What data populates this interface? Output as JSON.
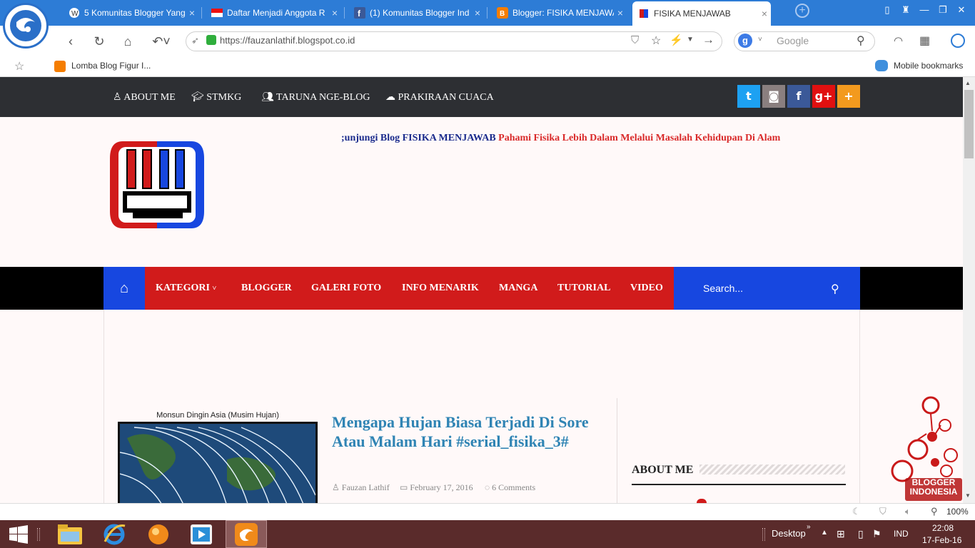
{
  "browser": {
    "tabs": [
      {
        "title": "5 Komunitas Blogger Yang",
        "favicon": "wordpress-icon"
      },
      {
        "title": "Daftar Menjadi Anggota R",
        "favicon": "indonesia-flag-icon"
      },
      {
        "title": "(1) Komunitas Blogger Ind",
        "favicon": "facebook-icon"
      },
      {
        "title": "Blogger: FISIKA MENJAWA",
        "favicon": "blogger-icon"
      },
      {
        "title": "FISIKA MENJAWAB",
        "favicon": "site-icon",
        "active": true
      }
    ],
    "url": "https://fauzanlathif.blogspot.co.id",
    "search_placeholder": "Google",
    "bookmarks": [
      {
        "label": "Lomba Blog Figur I..."
      }
    ],
    "mobile_bookmarks": "Mobile bookmarks",
    "zoom": "100%"
  },
  "site": {
    "top_nav": [
      "ABOUT ME",
      "STMKG",
      "TARUNA NGE-BLOG",
      "PRAKIRAAN CUACA"
    ],
    "social": [
      {
        "name": "twitter-icon",
        "glyph": "t",
        "color": "#1da1f2"
      },
      {
        "name": "instagram-icon",
        "glyph": "◙",
        "color": "#8a7f7f"
      },
      {
        "name": "facebook-icon",
        "glyph": "f",
        "color": "#3b5998"
      },
      {
        "name": "google-plus-icon",
        "glyph": "g+",
        "color": "#e01010"
      },
      {
        "name": "plus-icon",
        "glyph": "+",
        "color": "#f39a1e"
      }
    ],
    "marquee_part1": ";unjungi Blog FISIKA MENJAWAB",
    "marquee_part2": "Pahami Fisika Lebih Dalam Melalui Masalah Kehidupan Di Alam",
    "main_nav": [
      "KATEGORI",
      "BLOGGER",
      "GALERI FOTO",
      "INFO MENARIK",
      "MANGA",
      "TUTORIAL",
      "VIDEO"
    ],
    "search_placeholder": "Search...",
    "post": {
      "thumbnail_caption": "Monsun Dingin Asia (Musim Hujan)",
      "title": "Mengapa Hujan Biasa Terjadi Di Sore Atau Malam Hari #serial_fisika_3#",
      "author": "Fauzan Lathif",
      "date": "February 17, 2016",
      "comments": "6 Comments"
    },
    "sidebar_heading": "ABOUT ME",
    "badge_text": "BLOGGER INDONESIA"
  },
  "taskbar": {
    "desktop_label": "Desktop",
    "language": "IND",
    "time": "22:08",
    "date": "17-Feb-16"
  }
}
